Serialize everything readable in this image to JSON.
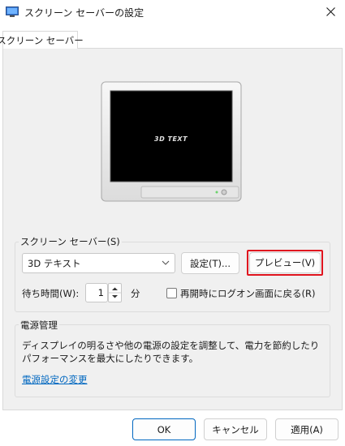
{
  "window": {
    "title": "スクリーン セーバーの設定",
    "close_icon": "close-icon"
  },
  "tabs": [
    {
      "label": "スクリーン セーバー",
      "selected": true
    }
  ],
  "preview": {
    "screen_text": "3D TEXT",
    "monitor_icon": "monitor-preview"
  },
  "screensaver_group": {
    "legend": "スクリーン セーバー(S)",
    "selected": "3D テキスト",
    "settings_label": "設定(T)...",
    "preview_label": "プレビュー(V)",
    "wait_label": "待ち時間(W):",
    "wait_value": "1",
    "wait_unit": "分",
    "resume_logon_label": "再開時にログオン画面に戻る(R)",
    "resume_logon_checked": false
  },
  "power_group": {
    "legend": "電源管理",
    "description_line1": "ディスプレイの明るさや他の電源の設定を調整して、電力を節約したり",
    "description_line2": "パフォーマンスを最大にしたりできます。",
    "link_label": "電源設定の変更"
  },
  "footer": {
    "ok_label": "OK",
    "cancel_label": "キャンセル",
    "apply_label": "適用(A)"
  },
  "colors": {
    "accent": "#0067c0",
    "highlight": "#e0141e"
  }
}
